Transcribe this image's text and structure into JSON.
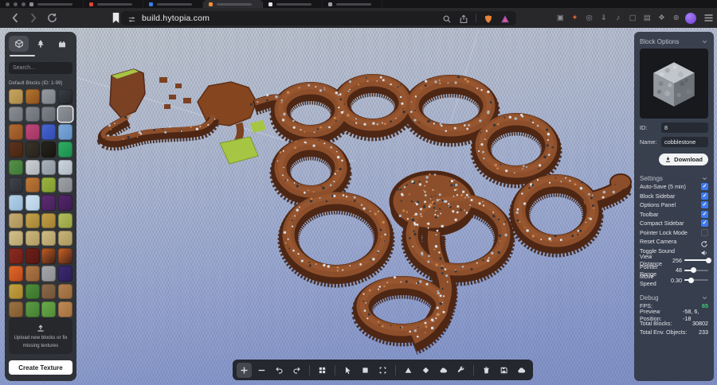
{
  "browser": {
    "window_control_color": "#5c5c60",
    "tabs": [
      {
        "favicon": "#8a8f96",
        "active": false
      },
      {
        "favicon": "#e04438",
        "active": false
      },
      {
        "favicon": "#3b7cf0",
        "active": false
      },
      {
        "favicon": "#f09030",
        "active": true
      },
      {
        "favicon": "#e6e6e8",
        "active": false
      },
      {
        "favicon": "#9aa0a6",
        "active": false
      }
    ],
    "url": "build.hytopia.com",
    "shield_color": "#e8833a",
    "triangle_color": "#a24fc0",
    "avatar_color": "#8a5cf0",
    "extensions": [
      {
        "name": "extension-box",
        "color": "#8d8d92"
      },
      {
        "name": "extension-flame",
        "color": "#d86a3a"
      },
      {
        "name": "extension-lasso",
        "color": "#8d8d92"
      },
      {
        "name": "extension-download",
        "color": "#8d8d92"
      },
      {
        "name": "extension-music",
        "color": "#8d8d92"
      },
      {
        "name": "extension-window",
        "color": "#8d8d92"
      },
      {
        "name": "extension-card",
        "color": "#8d8d92"
      },
      {
        "name": "extension-diamond",
        "color": "#8d8d92"
      },
      {
        "name": "extension-globe",
        "color": "#8d8d92"
      }
    ]
  },
  "sidebar": {
    "tabs": [
      {
        "name": "blocks",
        "active": true
      },
      {
        "name": "environment",
        "active": false
      },
      {
        "name": "structures",
        "active": false
      }
    ],
    "search_placeholder": "Search...",
    "section_label": "Default Blocks (ID: 1-99)",
    "selected_index": 7,
    "blocks": [
      [
        "#c9a55f",
        "#a8894a"
      ],
      [
        "#b5772f",
        "#8a4f1f"
      ],
      [
        "#969aa1",
        "#7a7f87"
      ],
      [
        "#3b3f46",
        "#22252a"
      ],
      [
        "#8b8e94",
        "#6f737a"
      ],
      [
        "#84878d",
        "#696d74"
      ],
      [
        "#7e8289",
        "#646871"
      ],
      [
        "#8f939a",
        "#73777e"
      ],
      [
        "#b06c33",
        "#8f4f22"
      ],
      [
        "#c2497c",
        "#9c3461"
      ],
      [
        "#4a66d0",
        "#2d4bb0"
      ],
      [
        "#7fa9d9",
        "#5f8cc4"
      ],
      [
        "#5e3422",
        "#46250f"
      ],
      [
        "#3a342a",
        "#262119"
      ],
      [
        "#27241e",
        "#17150f"
      ],
      [
        "#2fae66",
        "#1d8a4c"
      ],
      [
        "#58924a",
        "#3f7636"
      ],
      [
        "#ccd0d5",
        "#aeb3b9"
      ],
      [
        "#aab2ba",
        "#8b949e"
      ],
      [
        "#cdd6de",
        "#aeb8c2"
      ],
      [
        "#41454c",
        "#2b2f35"
      ],
      [
        "#bf7a3b",
        "#9c5c27"
      ],
      [
        "#9cb440",
        "#7e9930"
      ],
      [
        "#9fa2a6",
        "#84888d"
      ],
      [
        "#b5d2e8",
        "#93b8d6"
      ],
      [
        "#cfe3f2",
        "#b0cbe2"
      ],
      [
        "#5e2c72",
        "#44205a"
      ],
      [
        "#55276b",
        "#3c1b52"
      ],
      [
        "#c7ae74",
        "#a98f58"
      ],
      [
        "#c5a44c",
        "#a28336"
      ],
      [
        "#c2a048",
        "#9f8033"
      ],
      [
        "#b3bd5c",
        "#94a044"
      ],
      [
        "#d3c08a",
        "#b7a26e"
      ],
      [
        "#ccb77c",
        "#ae9a62"
      ],
      [
        "#cfbc83",
        "#b19e68"
      ],
      [
        "#c8b478",
        "#aa975f"
      ],
      [
        "#8e2c22",
        "#6d1e16"
      ],
      [
        "#70211a",
        "#531510"
      ],
      [
        "#c75c22",
        "#3a2017"
      ],
      [
        "#cf6323",
        "#43221a"
      ],
      [
        "#e06a28",
        "#b9481c"
      ],
      [
        "#b1794a",
        "#905c33"
      ],
      [
        "#a7a8ab",
        "#8b8d91"
      ],
      [
        "#3d2b72",
        "#2a1d55"
      ],
      [
        "#c5a342",
        "#a5852f"
      ],
      [
        "#4f8f3b",
        "#3a722b"
      ],
      [
        "#8c6b4a",
        "#705236"
      ],
      [
        "#b28050",
        "#956739"
      ],
      [
        "#9c7242",
        "#7e5a30"
      ],
      [
        "#5b9b45",
        "#447f33"
      ],
      [
        "#6aa94a",
        "#528c37"
      ],
      [
        "#c08b55",
        "#a16f3f"
      ]
    ],
    "upload_text": "Upload new blocks or fix missing textures",
    "create_button": "Create Texture"
  },
  "toolbar": {
    "items": [
      {
        "name": "add",
        "icon": "plus",
        "active": true
      },
      {
        "name": "remove",
        "icon": "minus"
      },
      {
        "name": "undo",
        "icon": "undo"
      },
      {
        "name": "redo",
        "icon": "redo"
      },
      {
        "separator": true
      },
      {
        "name": "grid-view",
        "icon": "grid"
      },
      {
        "separator": true
      },
      {
        "name": "pointer-tool",
        "icon": "cursor"
      },
      {
        "name": "fill-tool",
        "icon": "square"
      },
      {
        "name": "select-tool",
        "icon": "marquee"
      },
      {
        "separator": true
      },
      {
        "name": "terrain-tool",
        "icon": "pyramid"
      },
      {
        "name": "random-tool",
        "icon": "dice"
      },
      {
        "name": "brush-tool",
        "icon": "blob"
      },
      {
        "name": "settings-tool",
        "icon": "wrench"
      },
      {
        "separator": true
      },
      {
        "name": "delete-tool",
        "icon": "trash"
      },
      {
        "name": "save",
        "icon": "save"
      },
      {
        "name": "cloud-sync",
        "icon": "cloud"
      }
    ]
  },
  "panel": {
    "block_options": {
      "title": "Block Options",
      "id_label": "ID:",
      "id_value": "8",
      "name_label": "Name:",
      "name_value": "cobblestone",
      "download_label": "Download"
    },
    "settings": {
      "title": "Settings",
      "toggles": [
        {
          "label": "Auto-Save (5 min)",
          "checked": true
        },
        {
          "label": "Block Sidebar",
          "checked": true
        },
        {
          "label": "Options Panel",
          "checked": true
        },
        {
          "label": "Toolbar",
          "checked": true
        },
        {
          "label": "Compact Sidebar",
          "checked": true
        },
        {
          "label": "Pointer Lock Mode",
          "checked": false
        }
      ],
      "actions": [
        {
          "label": "Reset Camera",
          "icon": "reset"
        },
        {
          "label": "Toggle Sound",
          "icon": "speaker"
        }
      ],
      "sliders": [
        {
          "label": "View Distance",
          "value": "256",
          "pct": 100
        },
        {
          "label": "Pointer Range",
          "value": "48",
          "pct": 38
        },
        {
          "label": "Move Speed",
          "value": "0.30",
          "pct": 28
        }
      ]
    },
    "debug": {
      "title": "Debug",
      "rows": [
        {
          "label": "FPS:",
          "value": "65",
          "color": "#3ad173"
        },
        {
          "label": "Preview Position:",
          "value": "-58, 6, -18"
        },
        {
          "label": "Total Blocks:",
          "value": "30802"
        },
        {
          "label": "Total Env. Objects:",
          "value": "233"
        }
      ]
    }
  },
  "viewport": {
    "terrain_top_color": "#8d4f2b",
    "terrain_wall_color": "#4e2614",
    "grass_color": "#a6c643",
    "fps_green": "#3ad173"
  }
}
